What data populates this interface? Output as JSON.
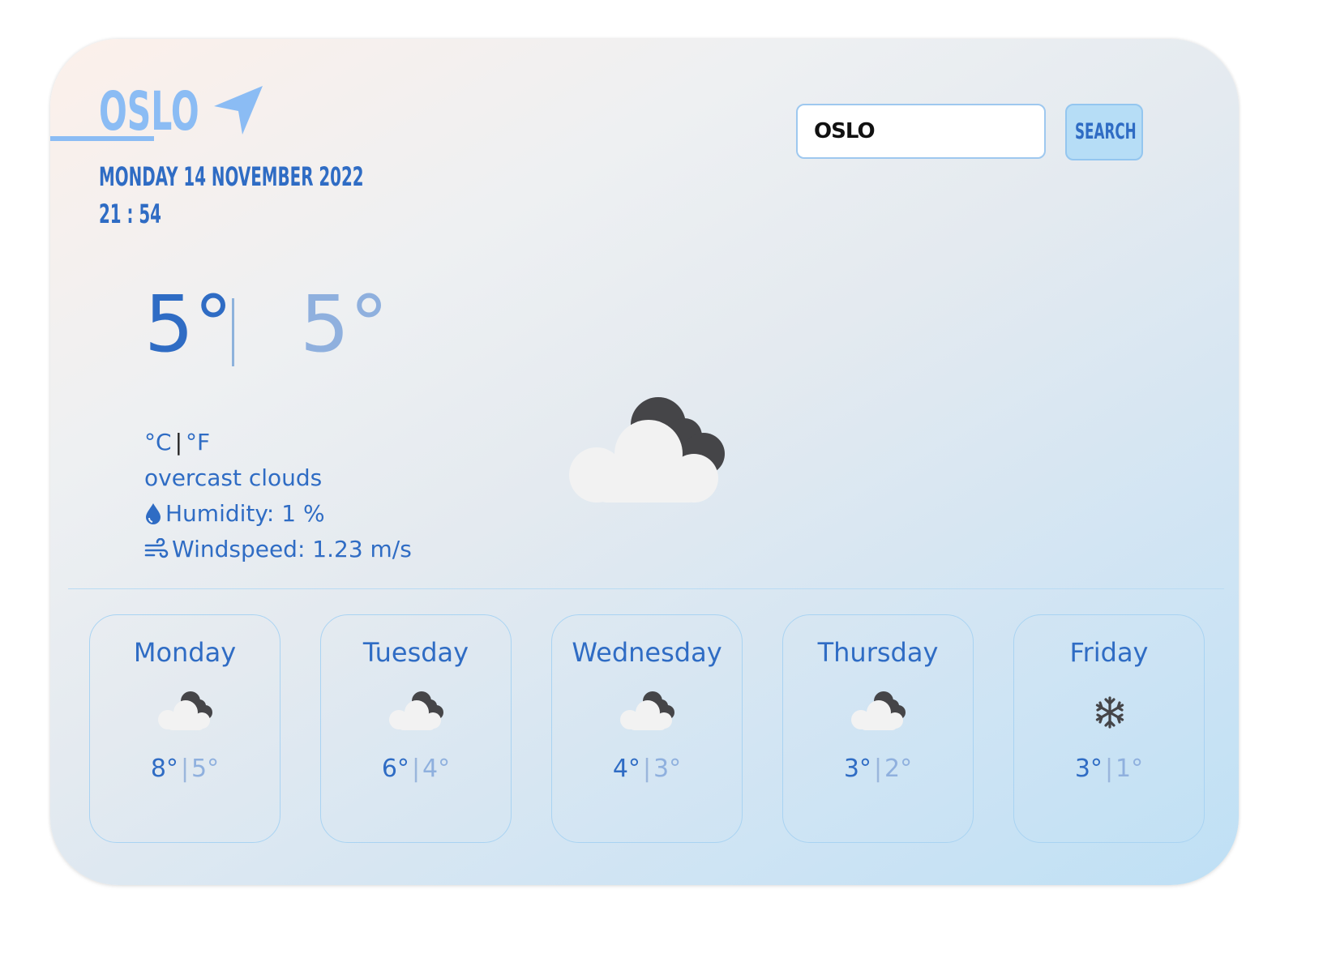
{
  "location": {
    "city": "OSLO",
    "date": "MONDAY 14 NOVEMBER 2022",
    "time": "21 : 54",
    "nav_icon": "location-arrow-icon"
  },
  "search": {
    "value": "OSLO",
    "button_label": "SEARCH"
  },
  "current": {
    "temp_c": "5°",
    "temp_f": "5°",
    "unit_c": "°C",
    "unit_sep": "|",
    "unit_f": "°F",
    "description": "overcast clouds",
    "humidity": "Humidity: 1 %",
    "windspeed": "Windspeed: 1.23 m/s",
    "icon": "overcast-clouds-icon"
  },
  "forecast": [
    {
      "day": "Monday",
      "high": "8°",
      "low": "5°",
      "icon": "overcast-clouds-icon"
    },
    {
      "day": "Tuesday",
      "high": "6°",
      "low": "4°",
      "icon": "overcast-clouds-icon"
    },
    {
      "day": "Wednesday",
      "high": "4°",
      "low": "3°",
      "icon": "overcast-clouds-icon"
    },
    {
      "day": "Thursday",
      "high": "3°",
      "low": "2°",
      "icon": "overcast-clouds-icon"
    },
    {
      "day": "Friday",
      "high": "3°",
      "low": "1°",
      "icon": "snowflake-icon"
    }
  ],
  "forecast_separator": "|",
  "colors": {
    "primary_blue": "#2f6cc4",
    "light_blue": "#8bbcf4",
    "muted_blue": "#8fb0de",
    "button_bg": "#b6ddf6",
    "border_blue": "#a9d3f2"
  }
}
